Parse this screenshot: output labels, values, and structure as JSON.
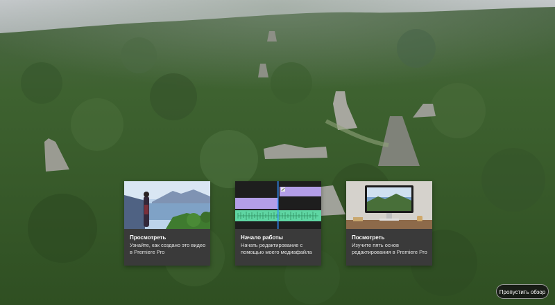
{
  "tutorial_cards": [
    {
      "title": "Просмотреть",
      "description": "Узнайте, как создано это видео в Premiere Pro",
      "thumbnail": "woman-by-lake-image"
    },
    {
      "title": "Начало работы",
      "description": "Начать редактирование с помощью моего медиафайла",
      "thumbnail": "timeline-image"
    },
    {
      "title": "Посмотреть",
      "description": "Изучите пять основ редактирования в Premiere Pro",
      "thumbnail": "monitor-on-desk-image"
    }
  ],
  "skip_button": {
    "label": "Пропустить обзор"
  },
  "colors": {
    "card_background": "#3a3a3a",
    "timeline_purple": "#b39ee8",
    "timeline_green": "#5fd6a3",
    "playhead_blue": "#2f8fff"
  }
}
